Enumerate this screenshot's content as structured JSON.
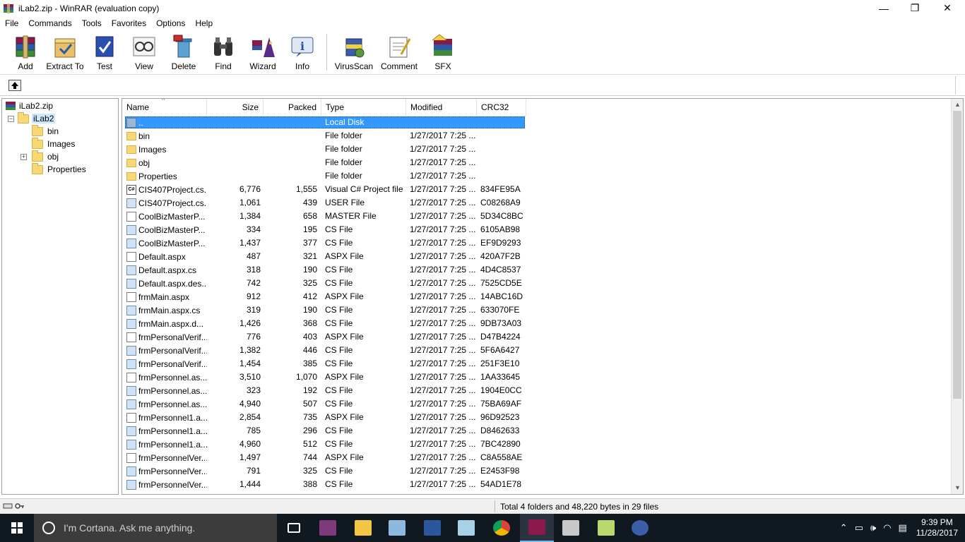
{
  "window": {
    "title": "iLab2.zip - WinRAR (evaluation copy)",
    "minimize": "—",
    "maximize": "❐",
    "close": "✕"
  },
  "menu": [
    "File",
    "Commands",
    "Tools",
    "Favorites",
    "Options",
    "Help"
  ],
  "toolbar": {
    "group1": [
      {
        "label": "Add",
        "icon": "add-icon"
      },
      {
        "label": "Extract To",
        "icon": "extract-icon"
      },
      {
        "label": "Test",
        "icon": "test-icon"
      },
      {
        "label": "View",
        "icon": "view-icon"
      },
      {
        "label": "Delete",
        "icon": "delete-icon"
      },
      {
        "label": "Find",
        "icon": "find-icon"
      },
      {
        "label": "Wizard",
        "icon": "wizard-icon"
      },
      {
        "label": "Info",
        "icon": "info-icon"
      }
    ],
    "group2": [
      {
        "label": "VirusScan",
        "icon": "virusscan-icon"
      },
      {
        "label": "Comment",
        "icon": "comment-icon"
      },
      {
        "label": "SFX",
        "icon": "sfx-icon"
      }
    ]
  },
  "tree": {
    "root": "iLab2.zip",
    "folder": "iLab2",
    "children": [
      "bin",
      "Images",
      "obj",
      "Properties"
    ]
  },
  "columns": {
    "name": "Name",
    "size": "Size",
    "packed": "Packed",
    "type": "Type",
    "modified": "Modified",
    "crc": "CRC32"
  },
  "files": [
    {
      "name": "..",
      "size": "",
      "packed": "",
      "type": "Local Disk",
      "modified": "",
      "crc": "",
      "kind": "up"
    },
    {
      "name": "bin",
      "size": "",
      "packed": "",
      "type": "File folder",
      "modified": "1/27/2017 7:25 ...",
      "crc": "",
      "kind": "folder"
    },
    {
      "name": "Images",
      "size": "",
      "packed": "",
      "type": "File folder",
      "modified": "1/27/2017 7:25 ...",
      "crc": "",
      "kind": "folder"
    },
    {
      "name": "obj",
      "size": "",
      "packed": "",
      "type": "File folder",
      "modified": "1/27/2017 7:25 ...",
      "crc": "",
      "kind": "folder"
    },
    {
      "name": "Properties",
      "size": "",
      "packed": "",
      "type": "File folder",
      "modified": "1/27/2017 7:25 ...",
      "crc": "",
      "kind": "folder"
    },
    {
      "name": "CIS407Project.cs...",
      "size": "6,776",
      "packed": "1,555",
      "type": "Visual C# Project file",
      "modified": "1/27/2017 7:25 ...",
      "crc": "834FE95A",
      "kind": "proj"
    },
    {
      "name": "CIS407Project.cs...",
      "size": "1,061",
      "packed": "439",
      "type": "USER File",
      "modified": "1/27/2017 7:25 ...",
      "crc": "C08268A9",
      "kind": "cs"
    },
    {
      "name": "CoolBizMasterP...",
      "size": "1,384",
      "packed": "658",
      "type": "MASTER File",
      "modified": "1/27/2017 7:25 ...",
      "crc": "5D34C8BC",
      "kind": "aspx"
    },
    {
      "name": "CoolBizMasterP...",
      "size": "334",
      "packed": "195",
      "type": "CS File",
      "modified": "1/27/2017 7:25 ...",
      "crc": "6105AB98",
      "kind": "cs"
    },
    {
      "name": "CoolBizMasterP...",
      "size": "1,437",
      "packed": "377",
      "type": "CS File",
      "modified": "1/27/2017 7:25 ...",
      "crc": "EF9D9293",
      "kind": "cs"
    },
    {
      "name": "Default.aspx",
      "size": "487",
      "packed": "321",
      "type": "ASPX File",
      "modified": "1/27/2017 7:25 ...",
      "crc": "420A7F2B",
      "kind": "aspx"
    },
    {
      "name": "Default.aspx.cs",
      "size": "318",
      "packed": "190",
      "type": "CS File",
      "modified": "1/27/2017 7:25 ...",
      "crc": "4D4C8537",
      "kind": "cs"
    },
    {
      "name": "Default.aspx.des...",
      "size": "742",
      "packed": "325",
      "type": "CS File",
      "modified": "1/27/2017 7:25 ...",
      "crc": "7525CD5E",
      "kind": "cs"
    },
    {
      "name": "frmMain.aspx",
      "size": "912",
      "packed": "412",
      "type": "ASPX File",
      "modified": "1/27/2017 7:25 ...",
      "crc": "14ABC16D",
      "kind": "aspx"
    },
    {
      "name": "frmMain.aspx.cs",
      "size": "319",
      "packed": "190",
      "type": "CS File",
      "modified": "1/27/2017 7:25 ...",
      "crc": "633070FE",
      "kind": "cs"
    },
    {
      "name": "frmMain.aspx.d...",
      "size": "1,426",
      "packed": "368",
      "type": "CS File",
      "modified": "1/27/2017 7:25 ...",
      "crc": "9DB73A03",
      "kind": "cs"
    },
    {
      "name": "frmPersonalVerif...",
      "size": "776",
      "packed": "403",
      "type": "ASPX File",
      "modified": "1/27/2017 7:25 ...",
      "crc": "D47B4224",
      "kind": "aspx"
    },
    {
      "name": "frmPersonalVerif...",
      "size": "1,382",
      "packed": "446",
      "type": "CS File",
      "modified": "1/27/2017 7:25 ...",
      "crc": "5F6A6427",
      "kind": "cs"
    },
    {
      "name": "frmPersonalVerif...",
      "size": "1,454",
      "packed": "385",
      "type": "CS File",
      "modified": "1/27/2017 7:25 ...",
      "crc": "251F3E10",
      "kind": "cs"
    },
    {
      "name": "frmPersonnel.as...",
      "size": "3,510",
      "packed": "1,070",
      "type": "ASPX File",
      "modified": "1/27/2017 7:25 ...",
      "crc": "1AA33645",
      "kind": "aspx"
    },
    {
      "name": "frmPersonnel.as...",
      "size": "323",
      "packed": "192",
      "type": "CS File",
      "modified": "1/27/2017 7:25 ...",
      "crc": "1904E0CC",
      "kind": "cs"
    },
    {
      "name": "frmPersonnel.as...",
      "size": "4,940",
      "packed": "507",
      "type": "CS File",
      "modified": "1/27/2017 7:25 ...",
      "crc": "75BA69AF",
      "kind": "cs"
    },
    {
      "name": "frmPersonnel1.a...",
      "size": "2,854",
      "packed": "735",
      "type": "ASPX File",
      "modified": "1/27/2017 7:25 ...",
      "crc": "96D92523",
      "kind": "aspx"
    },
    {
      "name": "frmPersonnel1.a...",
      "size": "785",
      "packed": "296",
      "type": "CS File",
      "modified": "1/27/2017 7:25 ...",
      "crc": "D8462633",
      "kind": "cs"
    },
    {
      "name": "frmPersonnel1.a...",
      "size": "4,960",
      "packed": "512",
      "type": "CS File",
      "modified": "1/27/2017 7:25 ...",
      "crc": "7BC42890",
      "kind": "cs"
    },
    {
      "name": "frmPersonnelVer...",
      "size": "1,497",
      "packed": "744",
      "type": "ASPX File",
      "modified": "1/27/2017 7:25 ...",
      "crc": "C8A558AE",
      "kind": "aspx"
    },
    {
      "name": "frmPersonnelVer...",
      "size": "791",
      "packed": "325",
      "type": "CS File",
      "modified": "1/27/2017 7:25 ...",
      "crc": "E2453F98",
      "kind": "cs"
    },
    {
      "name": "frmPersonnelVer...",
      "size": "1,444",
      "packed": "388",
      "type": "CS File",
      "modified": "1/27/2017 7:25 ...",
      "crc": "54AD1E78",
      "kind": "cs"
    }
  ],
  "selected_index": 0,
  "status": {
    "text": "Total 4 folders and 48,220 bytes in 29 files"
  },
  "taskbar": {
    "cortana_placeholder": "I'm Cortana. Ask me anything.",
    "apps": [
      {
        "name": "task-view-icon",
        "color": "#ffffff"
      },
      {
        "name": "onenote-icon",
        "color": "#80397b"
      },
      {
        "name": "file-explorer-icon",
        "color": "#f4c542"
      },
      {
        "name": "paint-icon",
        "color": "#8fb8de"
      },
      {
        "name": "word-icon",
        "color": "#2b579a"
      },
      {
        "name": "notepad-icon",
        "color": "#a8d0e6"
      },
      {
        "name": "chrome-icon",
        "color": "#db4437"
      },
      {
        "name": "winrar-icon",
        "color": "#8b1a4a"
      },
      {
        "name": "snipping-tool-icon",
        "color": "#c8c8c8"
      },
      {
        "name": "ie-folder-icon",
        "color": "#b8d86b"
      },
      {
        "name": "media-icon",
        "color": "#3a5ea8"
      }
    ],
    "time": "9:39 PM",
    "date": "11/28/2017"
  },
  "colors": {
    "selection": "#3399ff",
    "taskbar": "#101820",
    "folder": "#f8d775"
  }
}
